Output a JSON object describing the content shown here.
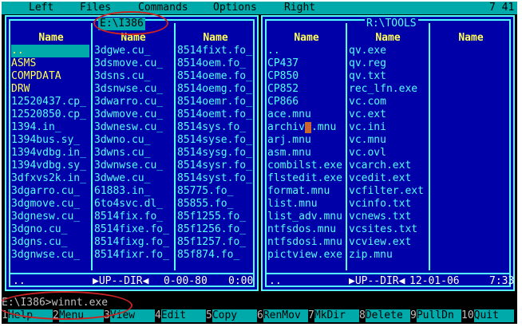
{
  "menu": {
    "left": "Left",
    "files": "Files",
    "commands": "Commands",
    "options": "Options",
    "right": "Right",
    "clock": "7 41"
  },
  "left_panel": {
    "title": "E:\\I386",
    "headers": [
      "Name",
      "Name",
      "Name"
    ],
    "col1": [
      "..",
      "ASMS",
      "COMPDATA",
      "DRW",
      "12520437.cp_",
      "12520850.cp_",
      "1394.in_",
      "1394bus.sy_",
      "1394vdbg.in_",
      "1394vdbg.sy_",
      "3dfxvs2k.in_",
      "3dgarro.cu_",
      "3dgmove.cu_",
      "3dgnesw.cu_",
      "3dgno.cu_",
      "3dgns.cu_",
      "3dgnwse.cu_"
    ],
    "col2": [
      "3dgwe.cu_",
      "3dsmove.cu_",
      "3dsns.cu_",
      "3dsnwse.cu_",
      "3dwarro.cu_",
      "3dwmove.cu_",
      "3dwnesw.cu_",
      "3dwno.cu_",
      "3dwns.cu_",
      "3dwnwse.cu_",
      "3dwwe.cu_",
      "61883.in_",
      "6to4svc.dl_",
      "8514fix.fo_",
      "8514fixe.fo_",
      "8514fixg.fo_",
      "8514fixr.fo_"
    ],
    "col3": [
      "8514fixt.fo_",
      "8514oem.fo_",
      "8514oeme.fo_",
      "8514oemg.fo_",
      "8514oemr.fo_",
      "8514oemt.fo_",
      "8514sys.fo_",
      "8514syse.fo_",
      "8514sysg.fo_",
      "8514sysr.fo_",
      "8514syst.fo_",
      "85775.fo_",
      "85855.fo_",
      "85f1255.fo_",
      "85f1256.fo_",
      "85f1257.fo_",
      "85f874.fo_"
    ],
    "status_name": "..",
    "status_dir": "▶UP--DIR◀",
    "status_date": "0-00-80",
    "status_time": "0:00"
  },
  "right_panel": {
    "title": "R:\\TOOLS",
    "headers": [
      "Name",
      "Name",
      "Name"
    ],
    "col1": [
      "..",
      "CP437",
      "CP850",
      "CP852",
      "CP866",
      "ace.mnu",
      "archivs.mnu",
      "arj.mnu",
      "asm.mnu",
      "combilst.exe",
      "flstedit.exe",
      "format.mnu",
      "list.mnu",
      "list_adv.mnu",
      "ntfsdos.mnu",
      "ntfsdosi.mnu",
      "pictview.exe"
    ],
    "col2": [
      "qv.exe",
      "qv.reg",
      "qv.txt",
      "rec_lfn.exe",
      "vc.com",
      "vc.ext",
      "vc.ini",
      "vc.mnu",
      "vc.ovl",
      "vcarch.ext",
      "vcedit.ext",
      "vcfilter.ext",
      "vcinfo.txt",
      "vcnews.txt",
      "vcsites.txt",
      "vcview.ext",
      "zip.mnu"
    ],
    "col3": [],
    "status_name": "..",
    "status_dir": "▶UP--DIR◀",
    "status_date": "12-01-06",
    "status_time": "7:33"
  },
  "command_line": "E:\\I386>winnt.exe",
  "fkeys": [
    {
      "num": "1",
      "label": "Help"
    },
    {
      "num": "2",
      "label": "Menu"
    },
    {
      "num": "3",
      "label": "View"
    },
    {
      "num": "4",
      "label": "Edit"
    },
    {
      "num": "5",
      "label": "Copy"
    },
    {
      "num": "6",
      "label": "RenMov"
    },
    {
      "num": "7",
      "label": "MkDir"
    },
    {
      "num": "8",
      "label": "Delete"
    },
    {
      "num": "9",
      "label": "PullDn"
    },
    {
      "num": "10",
      "label": "Quit"
    }
  ],
  "colors": {
    "panel_bg": "#0000a8",
    "border": "#55ffff",
    "header": "#ffff55",
    "highlight": "#00aaaa",
    "annotation": "#cc2222"
  }
}
